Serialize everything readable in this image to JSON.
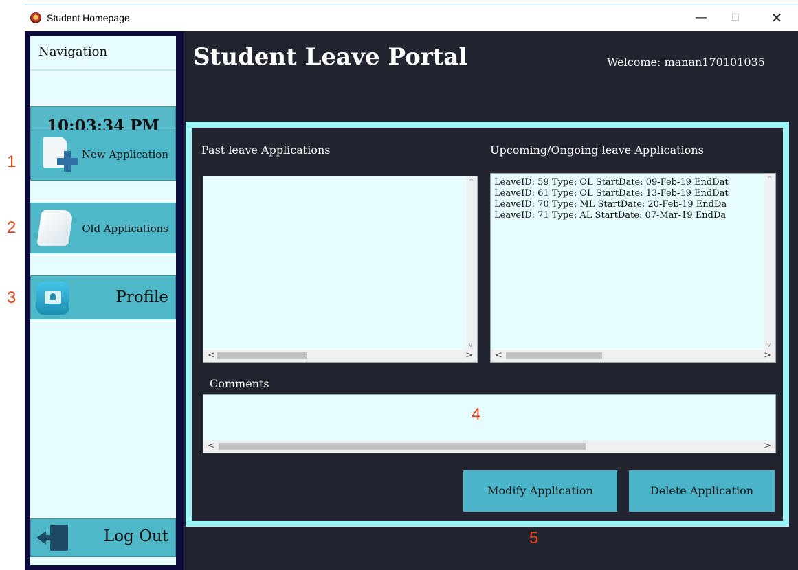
{
  "window": {
    "title": "Student Homepage",
    "controls": {
      "minimize": "—",
      "maximize": "☐",
      "close": "✕"
    }
  },
  "nav": {
    "title": "Navigation",
    "clock": "10:03:34 PM",
    "new_application": "New Application",
    "old_applications": "Old Applications",
    "profile": "Profile",
    "logout": "Log Out"
  },
  "header": {
    "title": "Student Leave Portal",
    "welcome": "Welcome: manan170101035"
  },
  "panels": {
    "past_label": "Past leave Applications",
    "upcoming_label": "Upcoming/Ongoing leave Applications",
    "upcoming_items": [
      "LeaveID: 59 Type: OL StartDate: 09-Feb-19 EndDat",
      "LeaveID: 61 Type: OL StartDate: 13-Feb-19 EndDat",
      "LeaveID: 70 Type: ML StartDate: 20-Feb-19 EndDa",
      "LeaveID: 71 Type: AL StartDate: 07-Mar-19 EndDa"
    ],
    "comments_label": "Comments"
  },
  "scroll": {
    "left": "<",
    "right": ">",
    "up": "^",
    "down": "v"
  },
  "actions": {
    "modify": "Modify Application",
    "delete": "Delete Application"
  },
  "annotations": [
    "1",
    "2",
    "3",
    "4",
    "5"
  ],
  "icons": [
    "new-document-icon",
    "folder-icon",
    "profile-icon",
    "logout-door-icon",
    "app-logo-icon"
  ],
  "colors": {
    "nav_button": "#4eb7c8",
    "panel_frame": "#9ef5f7",
    "background": "#22252f",
    "nav_border": "#0b0b3c",
    "annotation": "#e8441c"
  }
}
